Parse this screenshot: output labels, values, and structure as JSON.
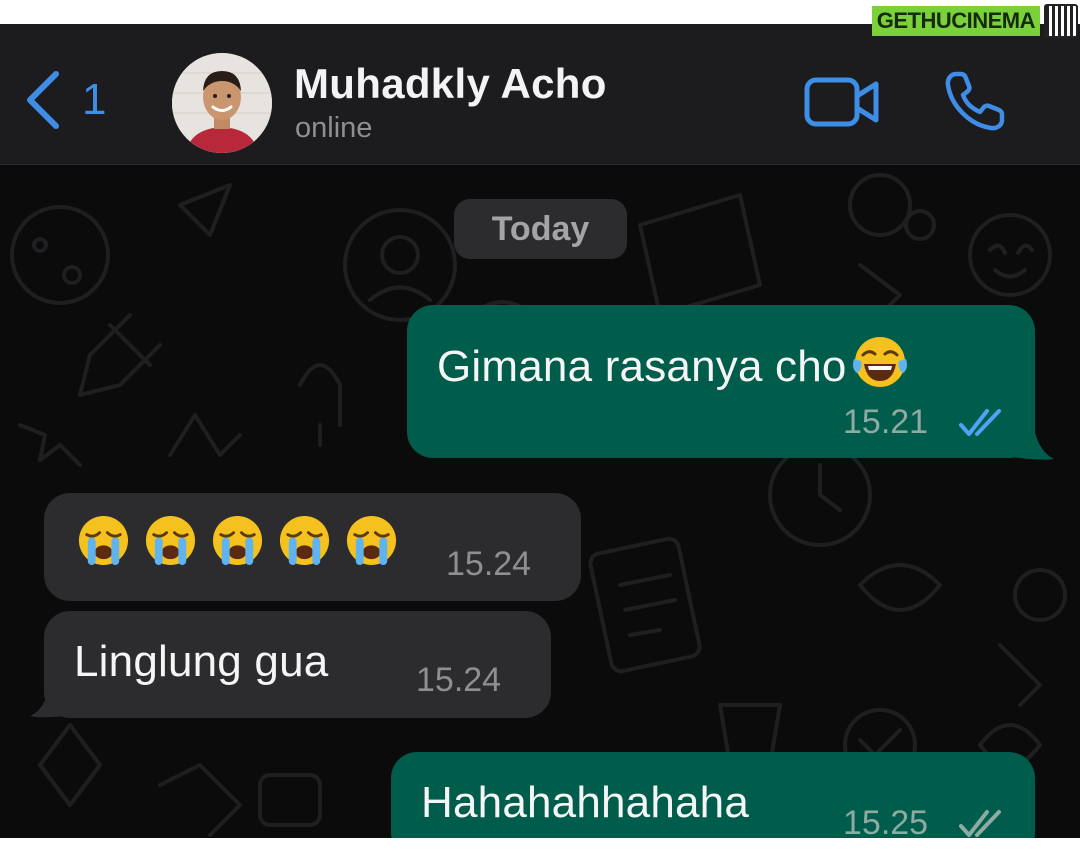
{
  "watermark": {
    "text": "GETHUCINEMA"
  },
  "header": {
    "back_count": "1",
    "contact_name": "Muhadkly Acho",
    "status": "online",
    "icons": {
      "back": "chevron-left-icon",
      "video": "video-camera-icon",
      "call": "phone-icon"
    },
    "accent_color": "#3e8ee8"
  },
  "chat": {
    "date_label": "Today",
    "messages": [
      {
        "direction": "outgoing",
        "text": "Gimana rasanya cho",
        "emoji": "face-with-tears-of-joy",
        "time": "15.21",
        "status": "read"
      },
      {
        "direction": "incoming",
        "emoji": [
          "loudly-crying-face",
          "loudly-crying-face",
          "loudly-crying-face",
          "loudly-crying-face",
          "loudly-crying-face"
        ],
        "time": "15.24"
      },
      {
        "direction": "incoming",
        "text": "Linglung gua",
        "time": "15.24"
      },
      {
        "direction": "outgoing",
        "text": "Hahahahhahaha",
        "time": "15.25",
        "status": "delivered"
      }
    ],
    "colors": {
      "outgoing_bubble": "#005c4b",
      "incoming_bubble": "#2c2c2e",
      "read_tick": "#4fa3f7",
      "delivered_tick": "#8fa9a3"
    }
  }
}
